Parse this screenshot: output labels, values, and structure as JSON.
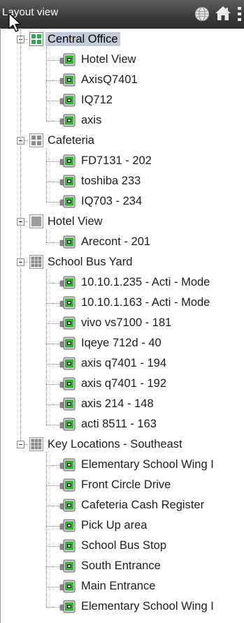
{
  "header": {
    "title": "Layout view",
    "icons": [
      "globe-icon",
      "home-icon",
      "menu-grip-icon"
    ]
  },
  "groups": [
    {
      "name": "Central Office",
      "icon": "group-grid-green-icon",
      "selected": true,
      "cameras": [
        "Hotel View",
        "AxisQ7401",
        "IQ712",
        "axis"
      ]
    },
    {
      "name": "Cafeteria",
      "icon": "group-grid-2x2-icon",
      "cameras": [
        "FD7131 - 202",
        "toshiba 233",
        "IQ703 - 234"
      ]
    },
    {
      "name": "Hotel View",
      "icon": "group-single-icon",
      "cameras": [
        "Arecont - 201"
      ]
    },
    {
      "name": "School Bus Yard",
      "icon": "group-grid-3x3-icon",
      "cameras": [
        "10.10.1.235 - Acti - Mode",
        "10.10.1.163 - Acti - Mode",
        "vivo vs7100 - 181",
        "Iqeye 712d - 40",
        "axis q7401 - 194",
        "axis q7401 - 192",
        "axis 214 - 148",
        "acti 8511 - 163"
      ]
    },
    {
      "name": "Key Locations - Southeast",
      "icon": "group-grid-3x3-icon",
      "cameras": [
        "Elementary School Wing I",
        "Front Circle Drive",
        "Cafeteria Cash Register",
        "Pick Up area",
        "School Bus Stop",
        "South Entrance",
        "Main Entrance",
        "Elementary School Wing I"
      ]
    }
  ],
  "colors": {
    "header_bg": "#3c3c3c",
    "selection": "#c4ccd9",
    "camera_green": "#2fbf2f",
    "group_green": "#2ea84a"
  }
}
